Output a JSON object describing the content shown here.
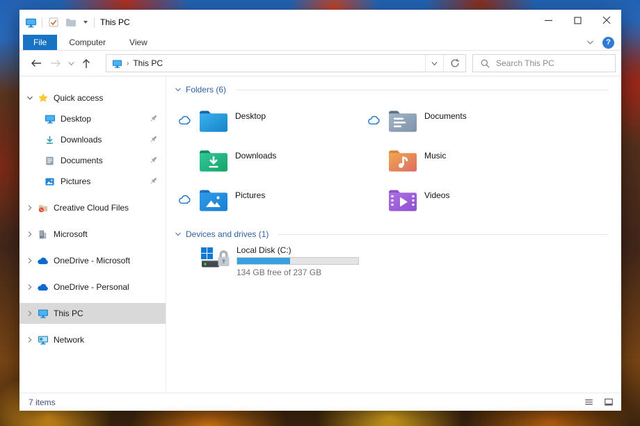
{
  "window": {
    "title": "This PC",
    "controls": {
      "minimize": "minimize",
      "maximize": "maximize",
      "close": "close"
    }
  },
  "ribbon": {
    "tabs": [
      {
        "label": "File",
        "active": true
      },
      {
        "label": "Computer",
        "active": false
      },
      {
        "label": "View",
        "active": false
      }
    ],
    "help_label": "?"
  },
  "toolbar": {
    "breadcrumb": "This PC",
    "breadcrumb_separator": "›",
    "search_placeholder": "Search This PC"
  },
  "sidebar": {
    "items": [
      {
        "label": "Quick access",
        "icon": "star",
        "level": 0,
        "expanded": true
      },
      {
        "label": "Desktop",
        "icon": "desktop-monitor",
        "level": 1,
        "pinned": true
      },
      {
        "label": "Downloads",
        "icon": "download-arrow",
        "level": 1,
        "pinned": true
      },
      {
        "label": "Documents",
        "icon": "document",
        "level": 1,
        "pinned": true
      },
      {
        "label": "Pictures",
        "icon": "picture",
        "level": 1,
        "pinned": true
      },
      {
        "label": "Creative Cloud Files",
        "icon": "creative-cloud-folder",
        "level": 0,
        "expanded": false
      },
      {
        "label": "Microsoft",
        "icon": "building",
        "level": 0,
        "expanded": false
      },
      {
        "label": "OneDrive - Microsoft",
        "icon": "onedrive-cloud",
        "level": 0,
        "expanded": false
      },
      {
        "label": "OneDrive - Personal",
        "icon": "onedrive-cloud",
        "level": 0,
        "expanded": false
      },
      {
        "label": "This PC",
        "icon": "this-pc-monitor",
        "level": 0,
        "expanded": false,
        "selected": true
      },
      {
        "label": "Network",
        "icon": "network",
        "level": 0,
        "expanded": false
      }
    ]
  },
  "content": {
    "folders": {
      "title": "Folders (6)",
      "tiles": [
        {
          "name": "Desktop",
          "icon": "folder-desktop",
          "cloud_status": true
        },
        {
          "name": "Documents",
          "icon": "folder-documents",
          "cloud_status": true
        },
        {
          "name": "Downloads",
          "icon": "folder-downloads",
          "cloud_status": false
        },
        {
          "name": "Music",
          "icon": "folder-music",
          "cloud_status": false
        },
        {
          "name": "Pictures",
          "icon": "folder-pictures",
          "cloud_status": true
        },
        {
          "name": "Videos",
          "icon": "folder-videos",
          "cloud_status": false
        }
      ]
    },
    "devices": {
      "title": "Devices and drives (1)",
      "drive": {
        "name": "Local Disk (C:)",
        "free_text": "134 GB free of 237 GB",
        "usage_percent": 43.5
      }
    }
  },
  "statusbar": {
    "items_count": "7 items"
  },
  "colors": {
    "accent": "#1873c5",
    "selection_gray": "#d9d9d9",
    "group_header_blue": "#2f5fa3",
    "drive_bar_fill": "#37a0e0",
    "cloud_icon_blue": "#0b6bc2"
  }
}
